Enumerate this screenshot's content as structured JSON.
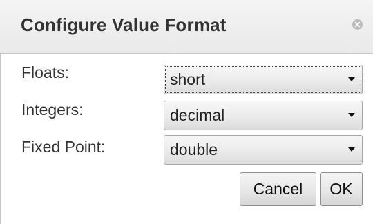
{
  "dialog": {
    "title": "Configure Value Format",
    "close_icon": "close-circle-icon"
  },
  "rows": [
    {
      "label": "Floats:",
      "value": "short"
    },
    {
      "label": "Integers:",
      "value": "decimal"
    },
    {
      "label": "Fixed Point:",
      "value": "double"
    }
  ],
  "buttons": {
    "cancel_label": "Cancel",
    "ok_label": "OK"
  },
  "colors": {
    "title_bar": "#eeeeee",
    "text": "#333333",
    "border": "#a7a7a7"
  }
}
